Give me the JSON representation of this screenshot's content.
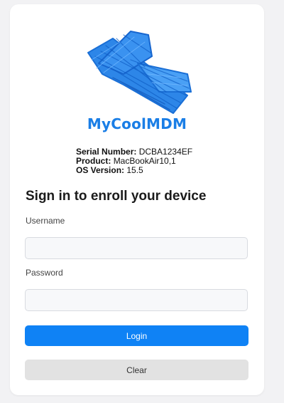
{
  "brand": {
    "name": "MyCoolMDM",
    "logo_icon": "blue-scribble-logo-icon",
    "color": "#1a7ee6"
  },
  "device": {
    "serial_label": "Serial Number:",
    "serial_value": "DCBA1234EF",
    "product_label": "Product:",
    "product_value": "MacBookAir10,1",
    "os_label": "OS Version:",
    "os_value": "15.5"
  },
  "form": {
    "heading": "Sign in to enroll your device",
    "username_label": "Username",
    "username_value": "",
    "password_label": "Password",
    "password_value": "",
    "login_label": "Login",
    "clear_label": "Clear"
  },
  "colors": {
    "primary": "#0f82f5",
    "secondary": "#e2e2e2",
    "background": "#f2f2f4"
  }
}
